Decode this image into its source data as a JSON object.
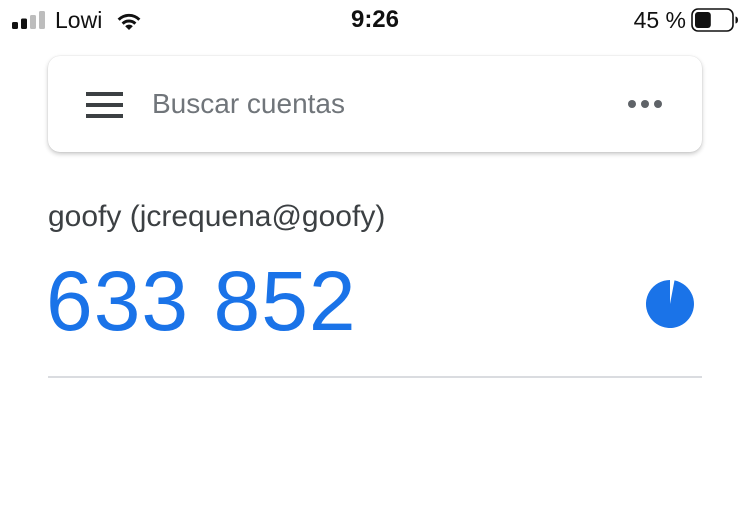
{
  "status_bar": {
    "carrier": "Lowi",
    "time": "9:26",
    "battery_percent": "45 %",
    "battery_level": 0.45,
    "signal_bars": 2,
    "signal_bars_total": 4,
    "signal_icon": "signal-strength-icon",
    "wifi_icon": "wifi-icon",
    "battery_icon": "battery-icon"
  },
  "search": {
    "placeholder": "Buscar cuentas",
    "menu_icon": "hamburger-menu-icon",
    "more_icon": "more-options-icon"
  },
  "accounts": [
    {
      "name": "goofy (jcrequena@goofy)",
      "code": "633 852",
      "time_remaining_fraction": 0.97,
      "timer_icon": "countdown-timer-icon"
    }
  ],
  "colors": {
    "accent": "#1a73e8",
    "text_primary": "#3c4043",
    "divider": "#dadce0"
  }
}
